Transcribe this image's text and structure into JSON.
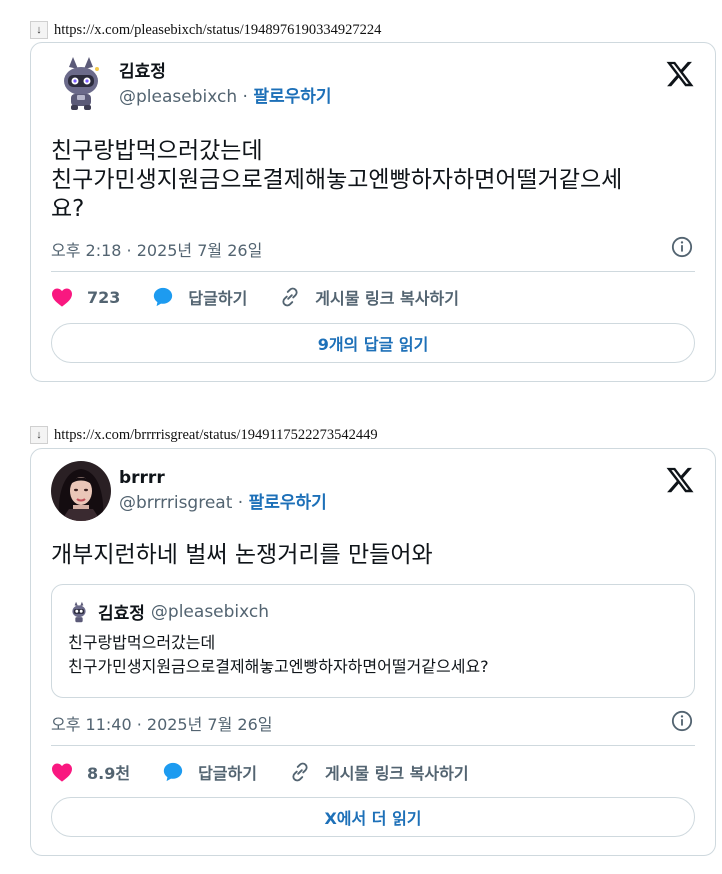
{
  "tweets": [
    {
      "url": "https://x.com/pleasebixch/status/1948976190334927224",
      "author_name": "김효정",
      "handle": "@pleasebixch",
      "separator": "·",
      "follow_label": "팔로우하기",
      "text_lines": [
        "친구랑밥먹으러갔는데",
        "친구가민생지원금으로결제해놓고엔빵하자하면어떨거같으세",
        "요?"
      ],
      "timestamp": "오후 2:18 · 2025년 7월 26일",
      "like_count": "723",
      "reply_label": "답글하기",
      "copy_link_label": "게시물 링크 복사하기",
      "read_button_label": "9개의 답글 읽기"
    },
    {
      "url": "https://x.com/brrrrisgreat/status/1949117522273542449",
      "author_name": "brrrr",
      "handle": "@brrrrisgreat",
      "separator": "·",
      "follow_label": "팔로우하기",
      "text_lines": [
        "개부지런하네 벌써 논쟁거리를 만들어와"
      ],
      "quote": {
        "author_name": "김효정",
        "handle": "@pleasebixch",
        "text_lines": [
          "친구랑밥먹으러갔는데",
          "친구가민생지원금으로결제해놓고엔빵하자하면어떨거같으세요?"
        ]
      },
      "timestamp": "오후 11:40 · 2025년 7월 26일",
      "like_count": "8.9천",
      "reply_label": "답글하기",
      "copy_link_label": "게시물 링크 복사하기",
      "read_button_label": "X에서 더 읽기"
    }
  ],
  "icons": {
    "download": "↓",
    "x_logo": "x-logo-icon",
    "heart": "heart-icon",
    "reply": "reply-bubble-icon",
    "link": "link-icon",
    "info": "info-icon"
  },
  "colors": {
    "heart": "#f91880",
    "reply": "#1d9bf0",
    "follow": "#1d70b8",
    "secondary_text": "#536471",
    "border": "#cfd9de"
  }
}
